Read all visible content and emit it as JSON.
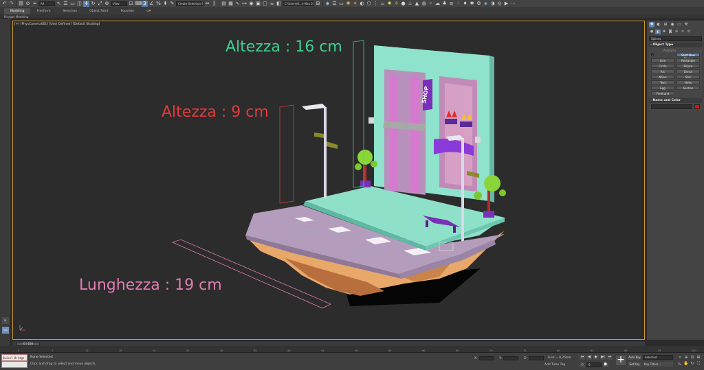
{
  "toolbar": {
    "undo": "↶",
    "redo": "↷",
    "link": "⛓",
    "unlink": "⊘",
    "selection_filter": "All",
    "select": "↖",
    "rect_select": "▭",
    "move": "✛",
    "rotate": "↻",
    "scale": "⤢",
    "coord_system": "View",
    "snap": "3",
    "angle_snap": "∠",
    "percent_snap": "%",
    "spinner_snap": "⬍",
    "named_selection": "Create Selection Se",
    "mirror": "⇔",
    "align": "⫿",
    "path": "C:\\Users\\G...e Max 2020",
    "icons_right": [
      "⊞",
      "⊟",
      "⛭",
      "☀",
      "◐",
      "✦",
      "☁",
      "⚙"
    ]
  },
  "ribbon": {
    "tabs": [
      "Modeling",
      "Freeform",
      "Selection",
      "Object Paint",
      "Populate"
    ],
    "sub_label": "Polygon Modeling"
  },
  "viewport": {
    "label": "[+] [PhysCamera001] [User Defined] [Default Shading]",
    "annotations": {
      "height_building": "Altezza : 16 cm",
      "height_lamp": "Altezza : 9 cm",
      "length": "Lunghezza : 19 cm"
    },
    "shop_sign": "SHOP",
    "accent_colors": {
      "green": "#3ecf8e",
      "red": "#e23a3a",
      "pink": "#e17cb4",
      "viewport_border": "#d49b26"
    }
  },
  "command_panel": {
    "category_dropdown": "Splines",
    "object_type_header": "Object Type",
    "autogrid_label": "AutoGrid",
    "start_new_shape_label": "Start New Shape",
    "buttons": [
      "Line",
      "Rectangle",
      "Circle",
      "Ellipse",
      "Arc",
      "Donut",
      "NGon",
      "Star",
      "Text",
      "Helix",
      "Egg",
      "Section",
      "Freehand"
    ],
    "name_color_header": "Name and Color",
    "color": "#e01010"
  },
  "timeline": {
    "frame_indicator": "0 / 100",
    "ticks": [
      "0",
      "5",
      "10",
      "15",
      "20",
      "25",
      "30",
      "35",
      "40",
      "45",
      "50",
      "55",
      "60",
      "65",
      "70",
      "75",
      "80",
      "85",
      "90",
      "95",
      "100"
    ]
  },
  "status": {
    "script_label": "Quixel Bridge",
    "selection_text": "None Selected",
    "hint_text": "Click and drag to select and move objects",
    "x_label": "X:",
    "y_label": "Y:",
    "z_label": "Z:",
    "grid_text": "Grid = 0,254m",
    "time_tag": "Add Time Tag",
    "auto_key": "Auto Key",
    "set_key": "Set Key",
    "selected_dropdown": "Selected",
    "key_filters": "Key Filters...",
    "frame_value": "0"
  }
}
